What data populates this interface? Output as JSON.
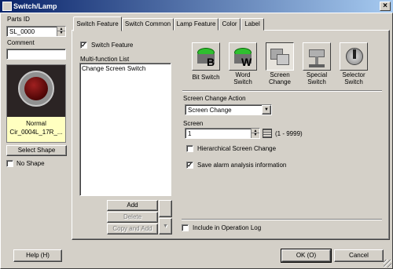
{
  "window": {
    "title": "Switch/Lamp",
    "close_glyph": "×"
  },
  "left": {
    "parts_id_label": "Parts ID",
    "parts_id_value": "SL_0000",
    "comment_label": "Comment",
    "comment_value": "",
    "preview_state": "Normal",
    "preview_name": "Cir_0004L_17R_...",
    "select_shape": "Select Shape",
    "no_shape": "No Shape",
    "no_shape_checked": false
  },
  "tabs": [
    {
      "label": "Switch Feature",
      "active": true
    },
    {
      "label": "Switch Common"
    },
    {
      "label": "Lamp Feature"
    },
    {
      "label": "Color"
    },
    {
      "label": "Label"
    }
  ],
  "switch_feature": {
    "checkbox_label": "Switch Feature",
    "checked": true,
    "list_label": "Multi-function List",
    "list_items": [
      "Change Screen Switch"
    ],
    "buttons": {
      "add": "Add",
      "delete": "Delete",
      "copy_add": "Copy and Add"
    },
    "types": [
      {
        "l1": "Bit Switch",
        "l2": "",
        "icon": "bit-switch-icon"
      },
      {
        "l1": "Word",
        "l2": "Switch",
        "icon": "word-switch-icon"
      },
      {
        "l1": "Screen",
        "l2": "Change",
        "icon": "screen-change-icon"
      },
      {
        "l1": "Special",
        "l2": "Switch",
        "icon": "special-switch-icon"
      },
      {
        "l1": "Selector",
        "l2": "Switch",
        "icon": "selector-switch-icon"
      }
    ],
    "action_label": "Screen Change Action",
    "action_value": "Screen Change",
    "screen_label": "Screen",
    "screen_value": "1",
    "screen_range": "(1 - 9999)",
    "hierarchical": "Hierarchical Screen Change",
    "hierarchical_checked": false,
    "save_alarm": "Save alarm analysis information",
    "save_alarm_checked": true,
    "include_log": "Include in Operation Log",
    "include_log_checked": false
  },
  "footer": {
    "help": "Help (H)",
    "ok": "OK (O)",
    "cancel": "Cancel"
  },
  "colors": {
    "title_start": "#0a246a",
    "title_end": "#a6caf0",
    "face": "#d4d0c8",
    "preview_label_bg": "#ffffc0",
    "lamp": "#5a0a0a"
  }
}
